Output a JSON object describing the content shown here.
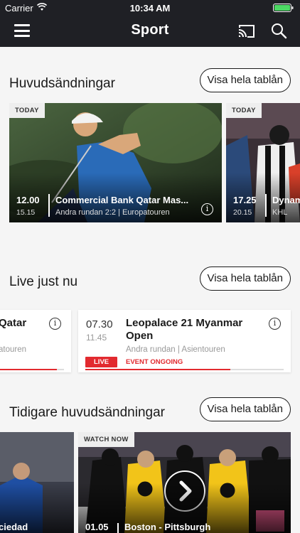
{
  "status": {
    "carrier": "Carrier",
    "time": "10:34 AM"
  },
  "nav": {
    "title": "Sport",
    "icons": [
      "menu-icon",
      "cast-icon",
      "search-icon"
    ]
  },
  "colors": {
    "topbar": "#1f2025",
    "live": "#e22a2f",
    "background": "#f5f5f5"
  },
  "sections": {
    "highlights": {
      "title": "Huvudsändningar",
      "button": "Visa hela tablån",
      "tiles": [
        {
          "tag": "TODAY",
          "start": "12.00",
          "end": "15.15",
          "title": "Commercial Bank Qatar Mas...",
          "subtitle": "Andra rundan 2:2 | Europatouren"
        },
        {
          "tag": "TODAY",
          "start": "17.25",
          "end": "20.15",
          "title": "Dynam",
          "subtitle": "KHL"
        }
      ]
    },
    "live": {
      "title": "Live just nu",
      "button": "Visa hela tablån",
      "cards": [
        {
          "title": "Qatar",
          "subtitle": "atouren",
          "progress": 0.9
        },
        {
          "start": "07.30",
          "end": "11.45",
          "title": "Leopalace 21 Myanmar Open",
          "subtitle": "Andra rundan | Asientouren",
          "badge": "LIVE",
          "event_label": "EVENT",
          "event_status": "ONGOING",
          "progress": 0.73
        }
      ]
    },
    "earlier": {
      "title": "Tidigare huvudsändningar",
      "button": "Visa hela tablån",
      "tiles": [
        {
          "title": "ciedad"
        },
        {
          "tag": "WATCH NOW",
          "start": "01.05",
          "title": "Boston - Pittsburgh"
        }
      ]
    }
  }
}
